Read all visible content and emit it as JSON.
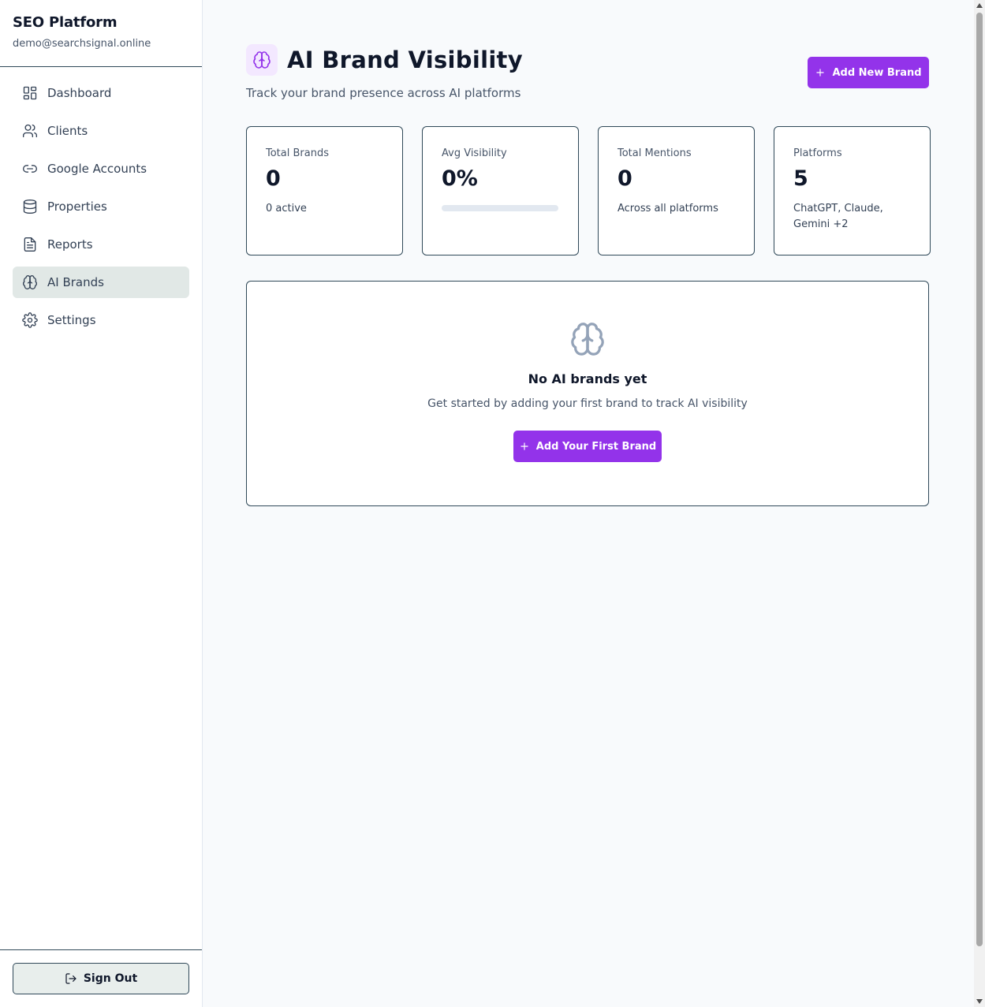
{
  "sidebar": {
    "app_name": "SEO Platform",
    "user_email": "demo@searchsignal.online",
    "items": [
      {
        "label": "Dashboard",
        "icon": "dashboard-icon"
      },
      {
        "label": "Clients",
        "icon": "users-icon"
      },
      {
        "label": "Google Accounts",
        "icon": "link-icon"
      },
      {
        "label": "Properties",
        "icon": "database-icon"
      },
      {
        "label": "Reports",
        "icon": "file-text-icon"
      },
      {
        "label": "AI Brands",
        "icon": "brain-icon",
        "active": true
      },
      {
        "label": "Settings",
        "icon": "gear-icon"
      }
    ],
    "sign_out_label": "Sign Out"
  },
  "header": {
    "title": "AI Brand Visibility",
    "subtitle": "Track your brand presence across AI platforms",
    "add_button_label": "Add New Brand"
  },
  "stats": [
    {
      "label": "Total Brands",
      "value": "0",
      "note": "0 active"
    },
    {
      "label": "Avg Visibility",
      "value": "0%",
      "progress": 0
    },
    {
      "label": "Total Mentions",
      "value": "0",
      "note": "Across all platforms"
    },
    {
      "label": "Platforms",
      "value": "5",
      "note": "ChatGPT, Claude, Gemini +2"
    }
  ],
  "empty_state": {
    "title": "No AI brands yet",
    "text": "Get started by adding your first brand to track AI visibility",
    "button_label": "Add Your First Brand"
  },
  "colors": {
    "accent": "#9333ea",
    "active_nav_bg": "#e1e8e6",
    "border": "#2f4858"
  }
}
